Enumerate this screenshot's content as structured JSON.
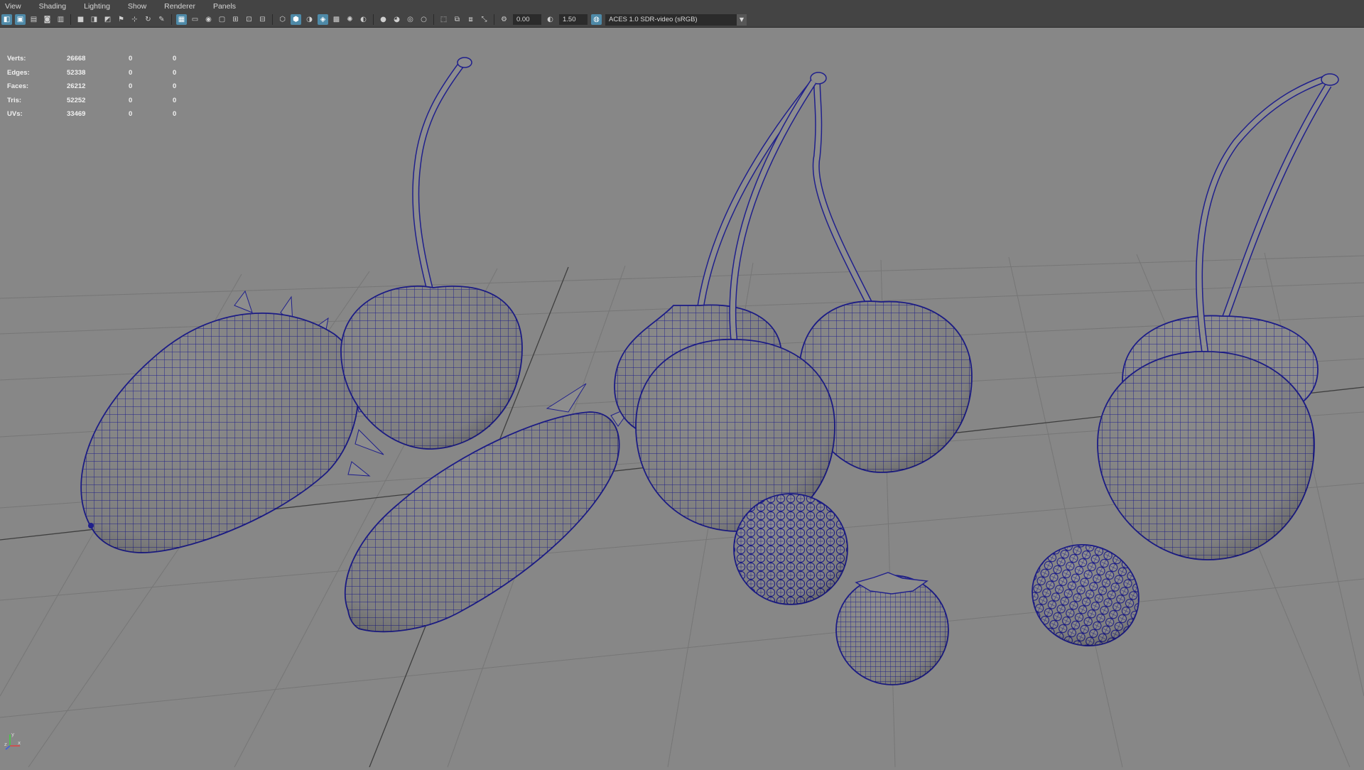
{
  "menubar": {
    "items": [
      "View",
      "Shading",
      "Lighting",
      "Show",
      "Renderer",
      "Panels"
    ]
  },
  "toolbar": {
    "exposure": "0.00",
    "gamma": "1.50",
    "color_management": "ACES 1.0 SDR-video (sRGB)",
    "accent_color": "#4e8aa8"
  },
  "hud": {
    "rows": [
      {
        "label": "Verts:",
        "values": [
          "26668",
          "0",
          "0"
        ]
      },
      {
        "label": "Edges:",
        "values": [
          "52338",
          "0",
          "0"
        ]
      },
      {
        "label": "Faces:",
        "values": [
          "26212",
          "0",
          "0"
        ]
      },
      {
        "label": "Tris:",
        "values": [
          "52252",
          "0",
          "0"
        ]
      },
      {
        "label": "UVs:",
        "values": [
          "33469",
          "0",
          "0"
        ]
      }
    ]
  },
  "axis": {
    "x": "x",
    "y": "y",
    "z": "z"
  },
  "colors": {
    "viewport": "#878787",
    "wireframe": "#1f1f8c",
    "mesh_fill": "#8c8c8c"
  }
}
